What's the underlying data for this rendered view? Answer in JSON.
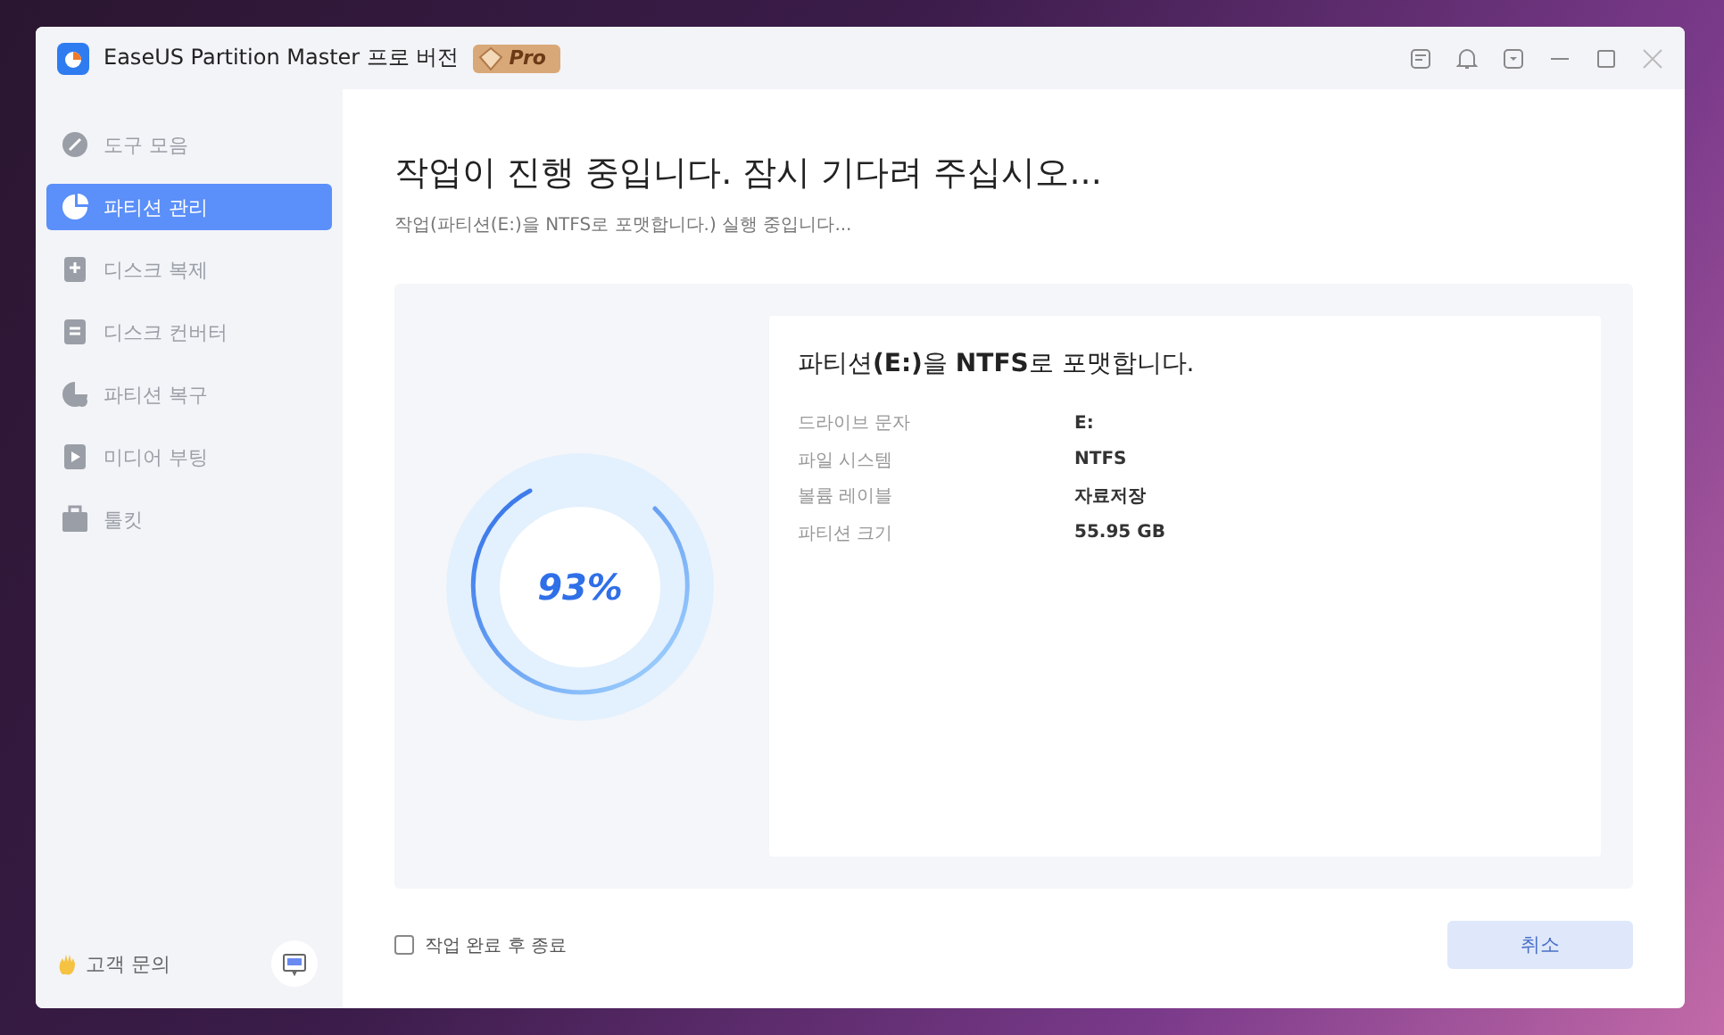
{
  "window": {
    "title": "EaseUS Partition Master 프로 버전",
    "badge": "Pro"
  },
  "sidebar": {
    "items": [
      {
        "label": "도구 모음",
        "selected": false,
        "disabled": true
      },
      {
        "label": "파티션 관리",
        "selected": true,
        "disabled": false
      },
      {
        "label": "디스크 복제",
        "selected": false,
        "disabled": true
      },
      {
        "label": "디스크 컨버터",
        "selected": false,
        "disabled": true
      },
      {
        "label": "파티션 복구",
        "selected": false,
        "disabled": true
      },
      {
        "label": "미디어 부팅",
        "selected": false,
        "disabled": true
      },
      {
        "label": "툴킷",
        "selected": false,
        "disabled": true
      }
    ],
    "support": "고객 문의"
  },
  "main": {
    "heading": "작업이 진행 중입니다. 잠시 기다려 주십시오...",
    "subheading": "작업(파티션(E:)을 NTFS로 포맷합니다.) 실행 중입니다...",
    "progress_text": "93%",
    "details": {
      "title": "파티션**(E:)**을 **NTFS**로 포맷합니다.",
      "rows": [
        {
          "label": "드라이브 문자",
          "value": "E:"
        },
        {
          "label": "파일 시스템",
          "value": "NTFS"
        },
        {
          "label": "볼륨 레이블",
          "value": "자료저장"
        },
        {
          "label": "파티션 크기",
          "value": "55.95 GB"
        }
      ]
    },
    "shutdown_option": {
      "label": "작업 완료 후 종료",
      "checked": false
    },
    "cancel_button": "취소"
  }
}
